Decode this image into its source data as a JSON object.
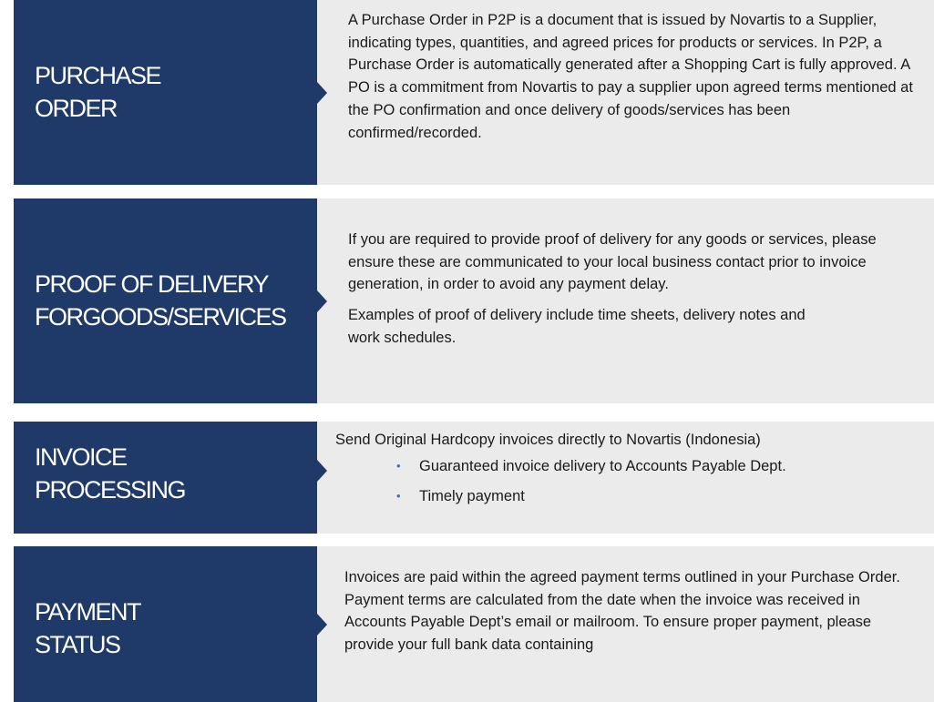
{
  "sections": [
    {
      "label": "PURCHASE\nORDER",
      "paragraphs": [
        "A Purchase Order in P2P is a document that is issued by Novartis to a Supplier, indicating types, quantities, and agreed prices for products or services. In P2P, a Purchase Order is automatically generated after a Shopping Cart is fully approved. A PO is a commitment from Novartis to pay a supplier upon agreed terms mentioned at the PO confirmation and once delivery of goods/services has been confirmed/recorded."
      ]
    },
    {
      "label": "PROOF OF DELIVERY\nFORGOODS/SERVICES",
      "paragraphs": [
        "If you are required to provide proof of delivery for any goods or services, please ensure these are communicated to your local business contact prior to invoice generation, in order to avoid any payment delay.",
        "Examples of proof of delivery include time sheets, delivery notes and work schedules."
      ]
    },
    {
      "label": "INVOICE\nPROCESSING",
      "paragraphs": [
        "Send Original Hardcopy invoices directly to Novartis (Indonesia)"
      ],
      "bullets": [
        "Guaranteed invoice delivery to Accounts Payable Dept.",
        "Timely payment"
      ]
    },
    {
      "label": "PAYMENT\nSTATUS",
      "paragraphs": [
        "Invoices are paid within the agreed payment terms outlined in your Purchase Order. Payment terms are calculated from the date when the invoice was received in Accounts Payable Dept’s email or mailroom. To ensure proper payment,  please provide your full bank data containing"
      ]
    }
  ],
  "colors": {
    "label_bg": "#1f3a68",
    "content_bg": "#ebebeb",
    "bullet": "#4a6ea8"
  }
}
